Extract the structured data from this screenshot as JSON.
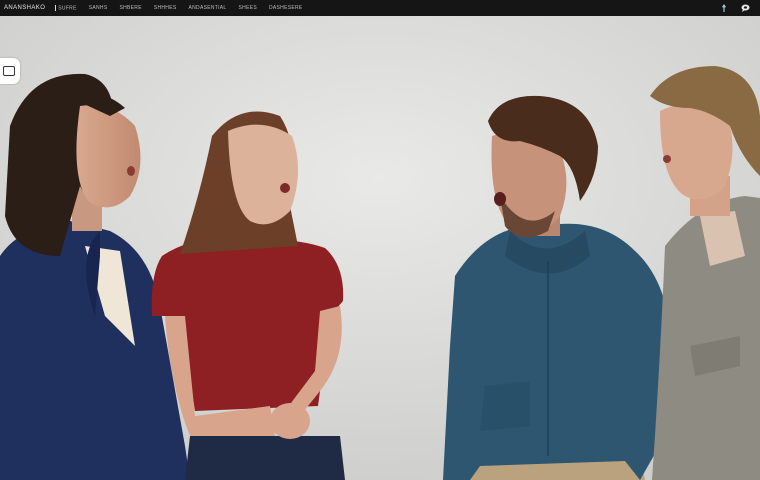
{
  "app": {
    "brand": "ANANSHAKO",
    "nav": [
      "SUFRE",
      "SANHS",
      "SHBERE",
      "SHHHES",
      "ANDASENTIAL",
      "SHEES",
      "DASHESERE"
    ]
  },
  "icons": {
    "left_control": "stop-square-icon",
    "top_right": [
      "pin-icon",
      "chat-icon"
    ]
  },
  "scene": {
    "description_none": ""
  }
}
